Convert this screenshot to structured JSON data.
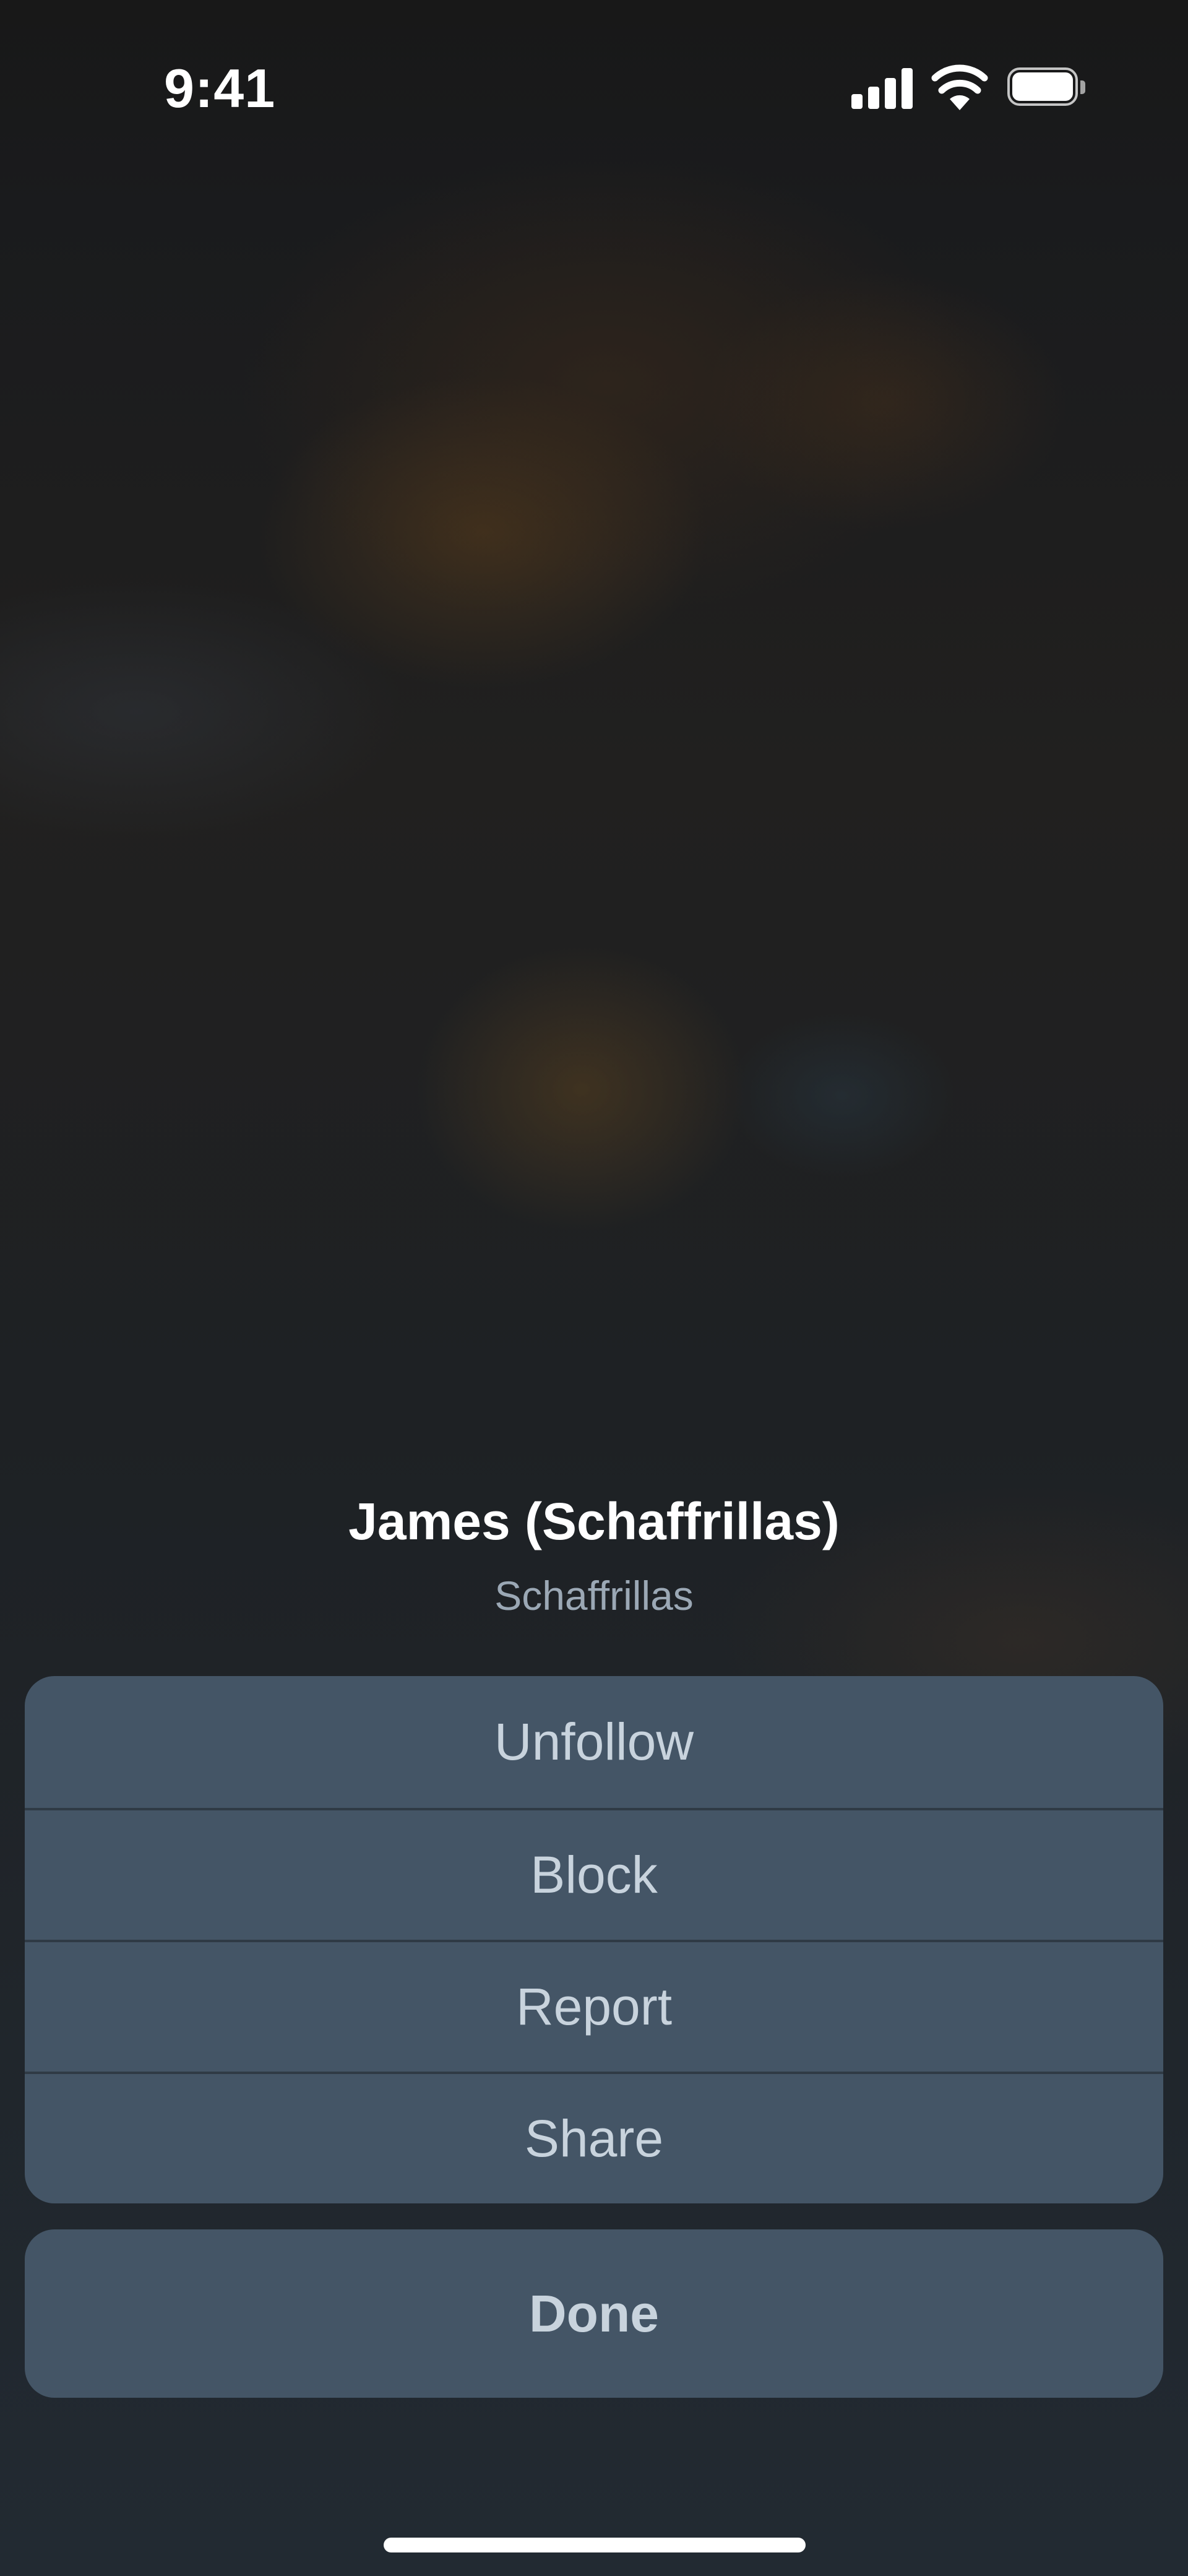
{
  "status_bar": {
    "time": "9:41"
  },
  "profile": {
    "name": "James (Schaffrillas)",
    "handle": "Schaffrillas"
  },
  "actions": [
    {
      "label": "Unfollow"
    },
    {
      "label": "Block"
    },
    {
      "label": "Report"
    },
    {
      "label": "Share"
    }
  ],
  "done_label": "Done",
  "colors": {
    "sheet_background": "#445566",
    "sheet_text": "#c8d3dd",
    "handle_text": "#9ba8b5"
  },
  "icons": [
    "signal-icon",
    "wifi-icon",
    "battery-icon"
  ]
}
